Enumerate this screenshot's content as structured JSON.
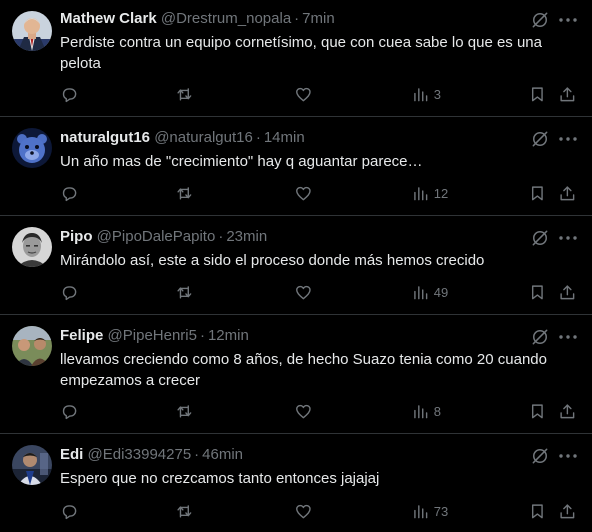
{
  "tweets": [
    {
      "name": "Mathew Clark",
      "handle": "@Drestrum_nopala",
      "separator": "·",
      "time": "7min",
      "text": "Perdiste contra un equipo cornetísimo, que con cuea sabe lo que es una pelota",
      "views": "3",
      "avatar_icon": "person-in-suit-avatar"
    },
    {
      "name": "naturalgut16",
      "handle": "@naturalgut16",
      "separator": "·",
      "time": "14min",
      "text": "Un año mas de \"crecimiento\" hay q aguantar parece…",
      "views": "12",
      "avatar_icon": "blue-bear-avatar"
    },
    {
      "name": "Pipo",
      "handle": "@PipoDalePapito",
      "separator": "·",
      "time": "23min",
      "text": "Mirándolo así, este a sido el proceso donde más hemos crecido",
      "views": "49",
      "avatar_icon": "grayscale-face-avatar"
    },
    {
      "name": "Felipe",
      "handle": "@PipeHenri5",
      "separator": "·",
      "time": "12min",
      "text": "llevamos creciendo como 8 años, de hecho Suazo tenia como 20 cuando empezamos a crecer",
      "views": "8",
      "avatar_icon": "group-photo-avatar"
    },
    {
      "name": "Edi",
      "handle": "@Edi33994275",
      "separator": "·",
      "time": "46min",
      "text": "Espero que no crezcamos tanto entonces jajajaj",
      "views": "73",
      "avatar_icon": "player-photo-avatar"
    }
  ],
  "colors": {
    "background": "#000000",
    "text": "#e7e9ea",
    "secondary": "#71767b",
    "divider": "#2f3336"
  }
}
